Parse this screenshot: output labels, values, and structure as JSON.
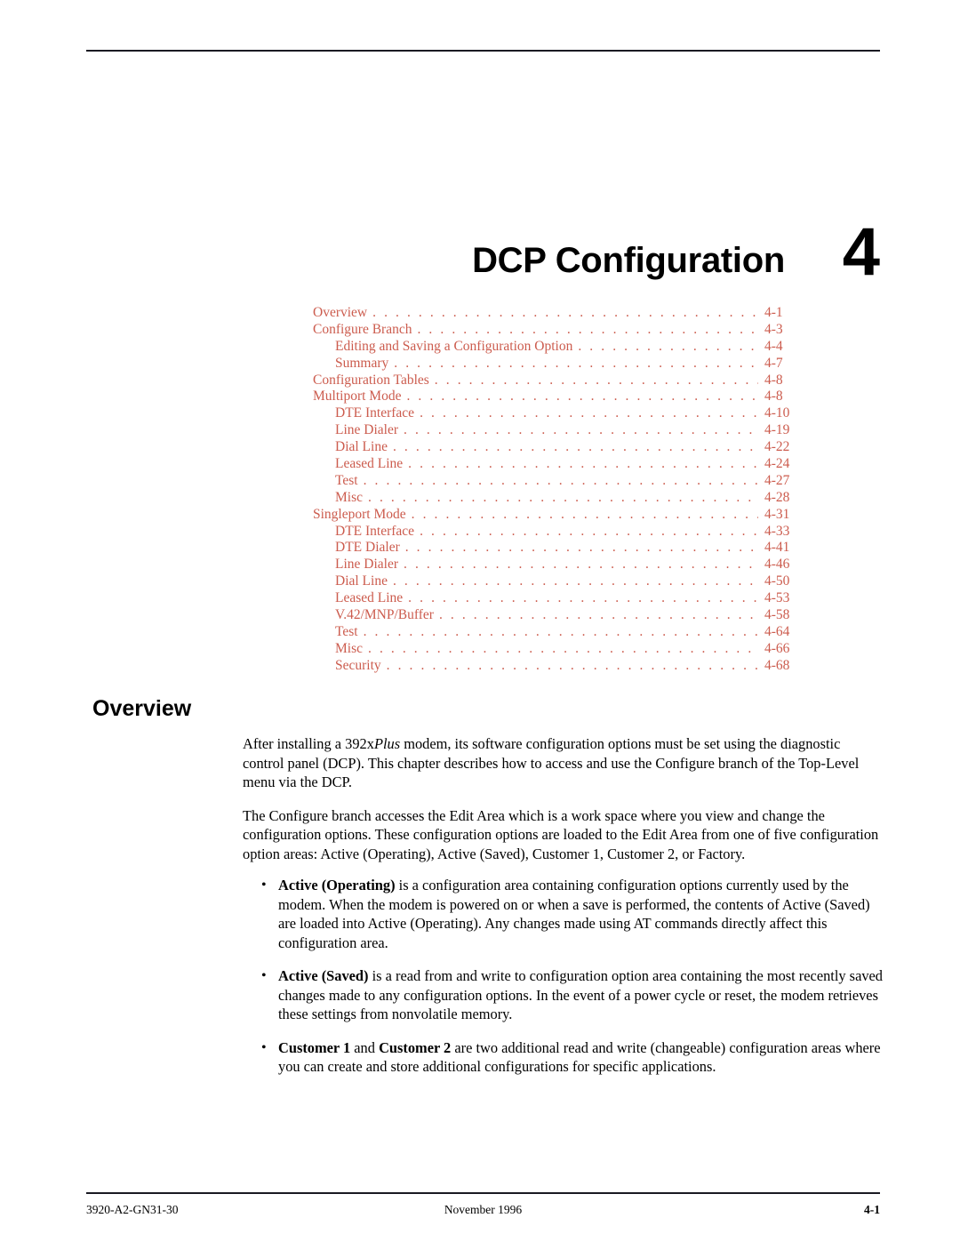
{
  "document": {
    "chapter_title": "DCP Configuration",
    "chapter_number": "4",
    "toc_color": "#cc5c4e"
  },
  "toc": {
    "entries": [
      {
        "label": "Overview",
        "page": "4-1",
        "level": 1
      },
      {
        "label": "Configure Branch",
        "page": "4-3",
        "level": 1
      },
      {
        "label": "Editing and Saving a Configuration Option",
        "page": "4-4",
        "level": 2
      },
      {
        "label": "Summary",
        "page": "4-7",
        "level": 2
      },
      {
        "label": "Configuration Tables",
        "page": "4-8",
        "level": 1
      },
      {
        "label": "Multiport Mode",
        "page": "4-8",
        "level": 1
      },
      {
        "label": "DTE Interface",
        "page": "4-10",
        "level": 2
      },
      {
        "label": "Line Dialer",
        "page": "4-19",
        "level": 2
      },
      {
        "label": "Dial Line",
        "page": "4-22",
        "level": 2
      },
      {
        "label": "Leased Line",
        "page": "4-24",
        "level": 2
      },
      {
        "label": "Test",
        "page": "4-27",
        "level": 2
      },
      {
        "label": "Misc",
        "page": "4-28",
        "level": 2
      },
      {
        "label": "Singleport Mode",
        "page": "4-31",
        "level": 1
      },
      {
        "label": "DTE Interface",
        "page": "4-33",
        "level": 2
      },
      {
        "label": "DTE Dialer",
        "page": "4-41",
        "level": 2
      },
      {
        "label": "Line Dialer",
        "page": "4-46",
        "level": 2
      },
      {
        "label": "Dial Line",
        "page": "4-50",
        "level": 2
      },
      {
        "label": "Leased Line",
        "page": "4-53",
        "level": 2
      },
      {
        "label": "V.42/MNP/Buffer",
        "page": "4-58",
        "level": 2
      },
      {
        "label": "Test",
        "page": "4-64",
        "level": 2
      },
      {
        "label": "Misc",
        "page": "4-66",
        "level": 2
      },
      {
        "label": "Security",
        "page": "4-68",
        "level": 2
      }
    ],
    "leader_dots": ". . . . . . . . . . . . . . . . . . . . . . . . . . . . . . . . . . . . . . . . . . . . . . . . . . . . . . . . . . . . . . . . . . . . . . . . . . . . . . . . . . . . . . . . . ."
  },
  "section": {
    "heading": "Overview",
    "paragraph_1_part1": "After installing a 392x",
    "paragraph_1_italic": "Plus",
    "paragraph_1_part2": " modem, its software configuration options must be set using the diagnostic control panel (DCP). This chapter describes how to access and use the Configure branch of the Top-Level menu via the DCP.",
    "paragraph_2": "The Configure branch accesses the Edit Area which is a work space where you view and change the configuration options. These configuration options are loaded to the Edit Area from one of five configuration option areas: Active (Operating), Active (Saved), Customer 1, Customer 2, or Factory.",
    "bullet_marker": "•",
    "bullets": [
      {
        "bold_lead": "Active (Operating)",
        "text": " is a configuration area containing configuration options currently used by the modem. When the modem is powered on or when a save is performed, the contents of Active (Saved) are loaded into Active (Operating). Any changes made using AT commands directly affect this configuration area."
      },
      {
        "bold_lead": "Active (Saved)",
        "text": " is a read from and write to configuration option area containing the most recently saved changes made to any configuration options. In the event of a power cycle or reset, the modem retrieves these settings from nonvolatile memory."
      },
      {
        "bold_lead": "Customer 1",
        "mid_text": " and ",
        "bold_lead2": "Customer 2",
        "text": " are two additional read and write (changeable) configuration areas where you can create and store additional configurations for specific applications."
      }
    ]
  },
  "footer": {
    "left": "3920-A2-GN31-30",
    "center": "November 1996",
    "right": "4-1"
  }
}
